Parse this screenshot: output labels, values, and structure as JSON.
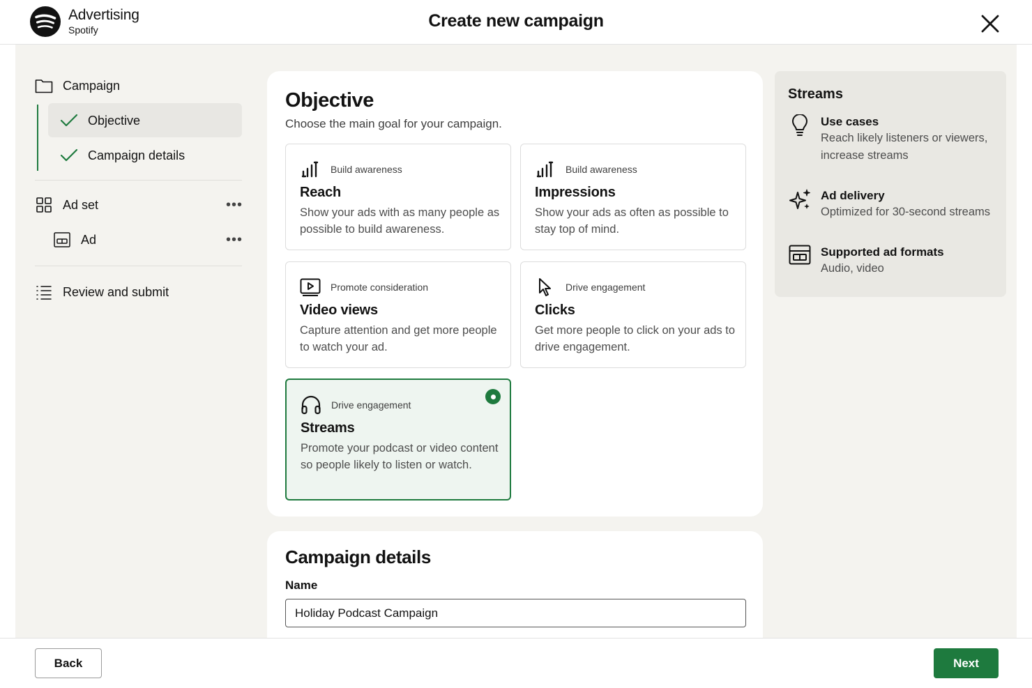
{
  "header": {
    "logo_title": "Advertising",
    "logo_subtitle": "Spotify",
    "page_title": "Create new campaign"
  },
  "sidebar": {
    "campaign": "Campaign",
    "objective": "Objective",
    "campaign_details": "Campaign details",
    "ad_set": "Ad set",
    "ad": "Ad",
    "review": "Review and submit",
    "more": "•••"
  },
  "objective": {
    "title": "Objective",
    "subtitle": "Choose the main goal for your campaign.",
    "options": [
      {
        "tag": "Build awareness",
        "title": "Reach",
        "description": "Show your ads with as many people as possible to build awareness.",
        "icon": "bar-chart-icon"
      },
      {
        "tag": "Build awareness",
        "title": "Impressions",
        "description": "Show your ads as often as possible to stay top of mind.",
        "icon": "bar-chart-icon"
      },
      {
        "tag": "Promote consideration",
        "title": "Video views",
        "description": "Capture attention and get more people to watch your ad.",
        "icon": "video-play-icon"
      },
      {
        "tag": "Drive engagement",
        "title": "Clicks",
        "description": "Get more people to click on your ads to drive engagement.",
        "icon": "cursor-icon"
      },
      {
        "tag": "Drive engagement",
        "title": "Streams",
        "description": "Promote your podcast or video content so people likely to listen or watch.",
        "icon": "headphones-icon",
        "selected": true
      }
    ]
  },
  "panel": {
    "title": "Streams",
    "items": [
      {
        "title": "Use cases",
        "description": "Reach likely listeners or viewers, increase streams",
        "icon": "lightbulb-icon"
      },
      {
        "title": "Ad delivery",
        "description": "Optimized for 30-second streams",
        "icon": "sparkle-icon"
      },
      {
        "title": "Supported ad formats",
        "description": "Audio, video",
        "icon": "ad-format-icon"
      }
    ]
  },
  "details": {
    "title": "Campaign details",
    "name_label": "Name",
    "name_value": "Holiday Podcast Campaign"
  },
  "footer": {
    "back": "Back",
    "next": "Next"
  },
  "colors": {
    "accent": "#1e7a3e",
    "canvas": "#f4f3ef",
    "panel": "#e9e8e3"
  }
}
